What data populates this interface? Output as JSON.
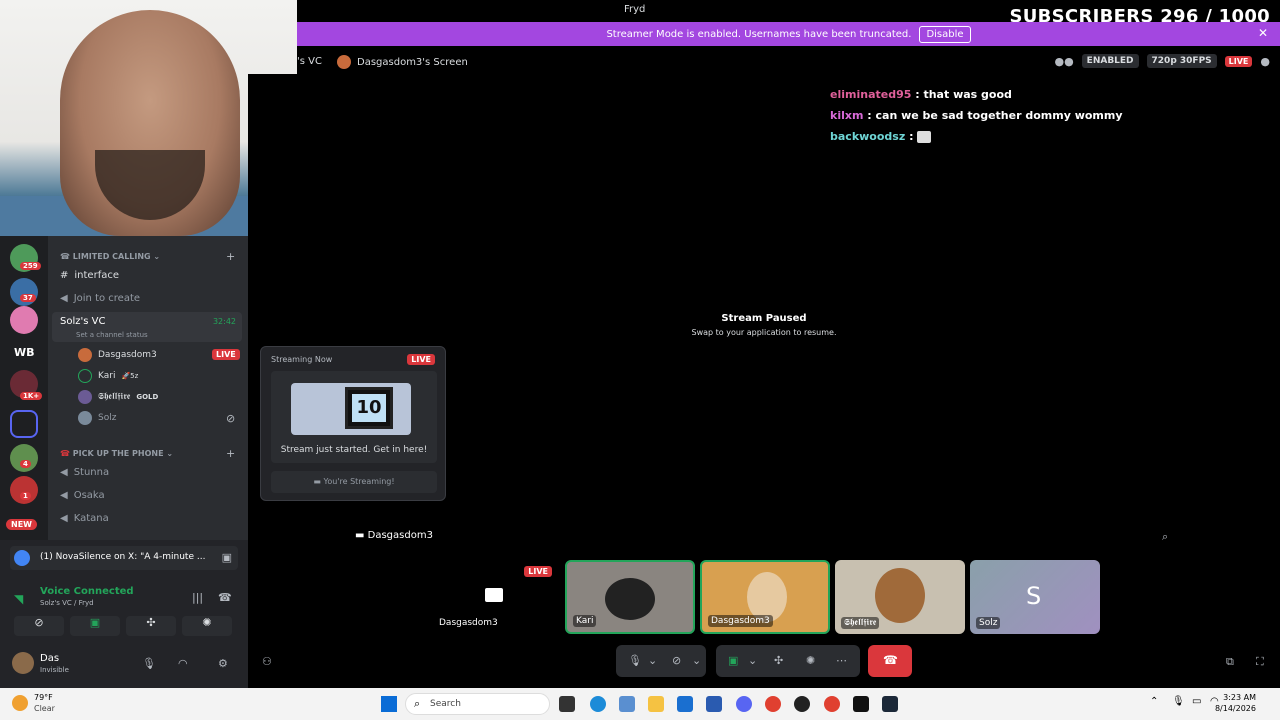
{
  "window": {
    "title": "Fryd"
  },
  "overlay": {
    "subscribers": "SUBSCRIBERS 296 / 1000"
  },
  "banner": {
    "text": "Streamer Mode is enabled. Usernames have been truncated.",
    "button": "Disable",
    "close": "✕"
  },
  "header": {
    "crumb": "'s VC",
    "screen_title": "Dasgasdom3's Screen",
    "enabled": "ENABLED",
    "quality": "720p 30FPS",
    "live": "LIVE"
  },
  "chat": [
    {
      "user": "eliminated95",
      "text": ": that was good",
      "color": "#e0609b"
    },
    {
      "user": "kilxm",
      "text": ": can we be sad together dommy wommy",
      "color": "#d86ad8"
    },
    {
      "user": "backwoodsz",
      "text": ":",
      "color": "#6fd6d6"
    }
  ],
  "stream": {
    "paused_title": "Stream Paused",
    "paused_sub": "Swap to your application to resume.",
    "streamer_label": "Dasgasdom3"
  },
  "servers": {
    "badges": [
      "259",
      "37",
      "1K+",
      "4",
      "1"
    ],
    "wb": "WB",
    "new": "NEW"
  },
  "channels": {
    "cat1": "LIMITED CALLING",
    "interface": "interface",
    "join": "Join to create",
    "vc_name": "Solz's VC",
    "vc_timer": "32:42",
    "vc_status": "Set a channel status",
    "members": [
      {
        "name": "Dasgasdom3",
        "tag": "LIVE"
      },
      {
        "name": "Kari",
        "tag": "🚀5z"
      },
      {
        "name": "𝕾𝖍𝖊𝖑𝖑𝖋𝖎𝖗𝖊",
        "tag": "GOLD"
      },
      {
        "name": "Solz",
        "tag": ""
      }
    ],
    "cat2": "PICK UP THE PHONE",
    "voice": [
      "Stunna",
      "Osaka",
      "Katana"
    ]
  },
  "popup": {
    "header": "Streaming Now",
    "live": "LIVE",
    "big": "10",
    "caption": "Stream just started. Get in here!",
    "button": "You're Streaming!"
  },
  "activity": {
    "text": "(1) NovaSilence on X: \"A 4-minute ..."
  },
  "voice": {
    "status": "Voice Connected",
    "channel": "Solz's VC / Fryd"
  },
  "user": {
    "name": "Das",
    "status": "Invisible"
  },
  "tiles": [
    {
      "label": "Dasgasdom3",
      "live": "LIVE"
    },
    {
      "label": "Kari"
    },
    {
      "label": "Dasgasdom3"
    },
    {
      "label": "𝕾𝖍𝖊𝖑𝖑𝖋𝖎𝖗𝖊"
    },
    {
      "label": "Solz",
      "initial": "S"
    }
  ],
  "taskbar": {
    "temp": "79°F",
    "weather": "Clear",
    "search": "Search",
    "time": "3:23 AM",
    "date": "8/14/2026"
  }
}
